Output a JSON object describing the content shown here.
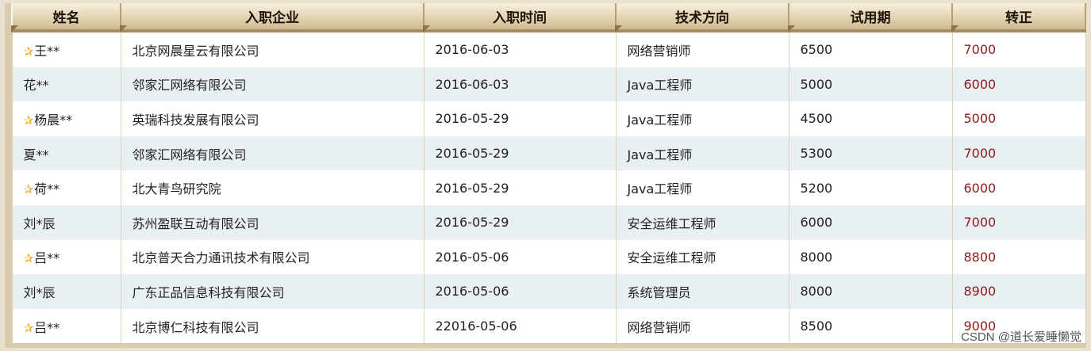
{
  "columns": [
    "姓名",
    "入职企业",
    "入职时间",
    "技术方向",
    "试用期",
    "转正"
  ],
  "rows": [
    {
      "star": true,
      "name": "王**",
      "company": "北京网晨星云有限公司",
      "date": "2016-06-03",
      "direction": "网络营销师",
      "probation": "6500",
      "regular": "7000"
    },
    {
      "star": false,
      "name": "花**",
      "company": "邻家汇网络有限公司",
      "date": "2016-06-03",
      "direction": "Java工程师",
      "probation": "5000",
      "regular": "6000"
    },
    {
      "star": true,
      "name": "杨晨**",
      "company": "英瑞科技发展有限公司",
      "date": "2016-05-29",
      "direction": "Java工程师",
      "probation": "4500",
      "regular": "5000"
    },
    {
      "star": false,
      "name": "夏**",
      "company": "邻家汇网络有限公司",
      "date": "2016-05-29",
      "direction": "Java工程师",
      "probation": "5300",
      "regular": "7000"
    },
    {
      "star": true,
      "name": "荷**",
      "company": "北大青鸟研究院",
      "date": "2016-05-29",
      "direction": "Java工程师",
      "probation": "5200",
      "regular": "6000"
    },
    {
      "star": false,
      "name": "刘*辰",
      "company": "苏州盈联互动有限公司",
      "date": "2016-05-29",
      "direction": "安全运维工程师",
      "probation": "6000",
      "regular": "7000"
    },
    {
      "star": true,
      "name": "吕**",
      "company": "北京普天合力通讯技术有限公司",
      "date": "2016-05-06",
      "direction": "安全运维工程师",
      "probation": "8000",
      "regular": "8800"
    },
    {
      "star": false,
      "name": "刘*辰",
      "company": "广东正品信息科技有限公司",
      "date": "2016-05-06",
      "direction": "系统管理员",
      "probation": "8000",
      "regular": "8900"
    },
    {
      "star": true,
      "name": "吕**",
      "company": "北京博仁科技有限公司",
      "date": "22016-05-06",
      "direction": "网络营销师",
      "probation": "8500",
      "regular": "9000"
    }
  ],
  "star_icon": "star-icon",
  "watermark": "CSDN @道长爱睡懒觉"
}
